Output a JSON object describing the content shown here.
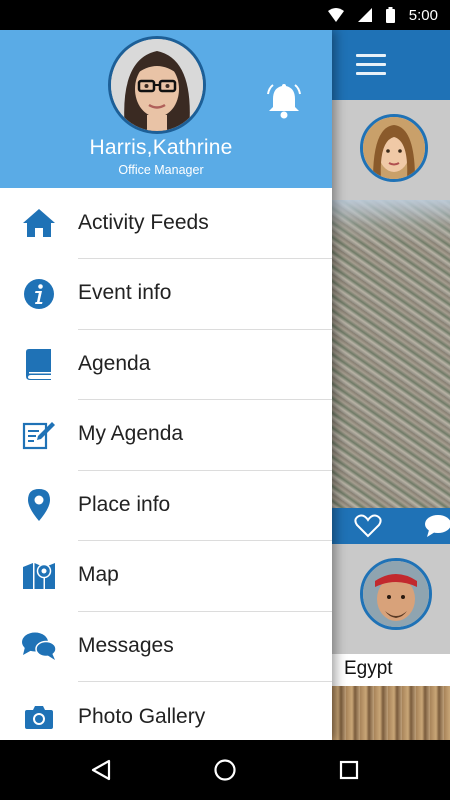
{
  "status_bar": {
    "time": "5:00"
  },
  "profile": {
    "name": "Harris,Kathrine",
    "role": "Office Manager"
  },
  "menu": {
    "items": [
      {
        "label": "Activity Feeds",
        "icon": "home-icon"
      },
      {
        "label": "Event info",
        "icon": "info-icon"
      },
      {
        "label": "Agenda",
        "icon": "book-icon"
      },
      {
        "label": "My Agenda",
        "icon": "edit-note-icon"
      },
      {
        "label": "Place info",
        "icon": "location-pin-icon"
      },
      {
        "label": "Map",
        "icon": "map-icon"
      },
      {
        "label": "Messages",
        "icon": "chat-bubbles-icon"
      },
      {
        "label": "Photo Gallery",
        "icon": "camera-icon"
      }
    ]
  },
  "feed": {
    "caption": "Egypt"
  },
  "colors": {
    "accent": "#1f72b6",
    "header": "#5aabe6"
  }
}
